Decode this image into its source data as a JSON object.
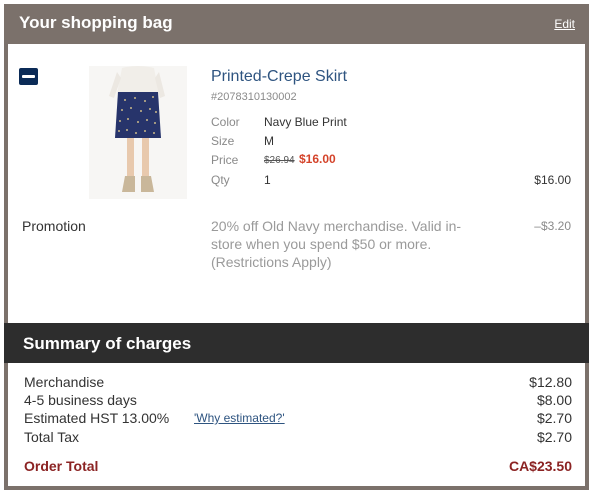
{
  "bag": {
    "title": "Your shopping bag",
    "edit_label": "Edit",
    "item": {
      "brand_logo": "old-navy-logo",
      "name": "Printed-Crepe Skirt",
      "sku": "#2078310130002",
      "color_label": "Color",
      "color_value": "Navy Blue Print",
      "size_label": "Size",
      "size_value": "M",
      "price_label": "Price",
      "price_original": "$26.94",
      "price_sale": "$16.00",
      "qty_label": "Qty",
      "qty_value": "1",
      "line_total": "$16.00"
    },
    "promotion": {
      "label": "Promotion",
      "text": "20% off Old Navy merchandise. Valid in-store when you spend $50 or more. (Restrictions Apply)",
      "amount": "–$3.20"
    }
  },
  "summary": {
    "title": "Summary of charges",
    "rows": [
      {
        "label": "Merchandise",
        "amount": "$12.80"
      },
      {
        "label": "4-5 business days",
        "amount": "$8.00"
      },
      {
        "label": "Estimated HST 13.00%",
        "amount": "$2.70",
        "link": "'Why estimated?'"
      },
      {
        "label": "Total Tax",
        "amount": "$2.70"
      }
    ],
    "total_label": "Order Total",
    "total_amount": "CA$23.50"
  },
  "colors": {
    "header_bg": "#7b716b",
    "summary_bg": "#2d2d2d",
    "link": "#2e5480",
    "sale_price": "#d4432a",
    "order_total": "#8b2323"
  }
}
